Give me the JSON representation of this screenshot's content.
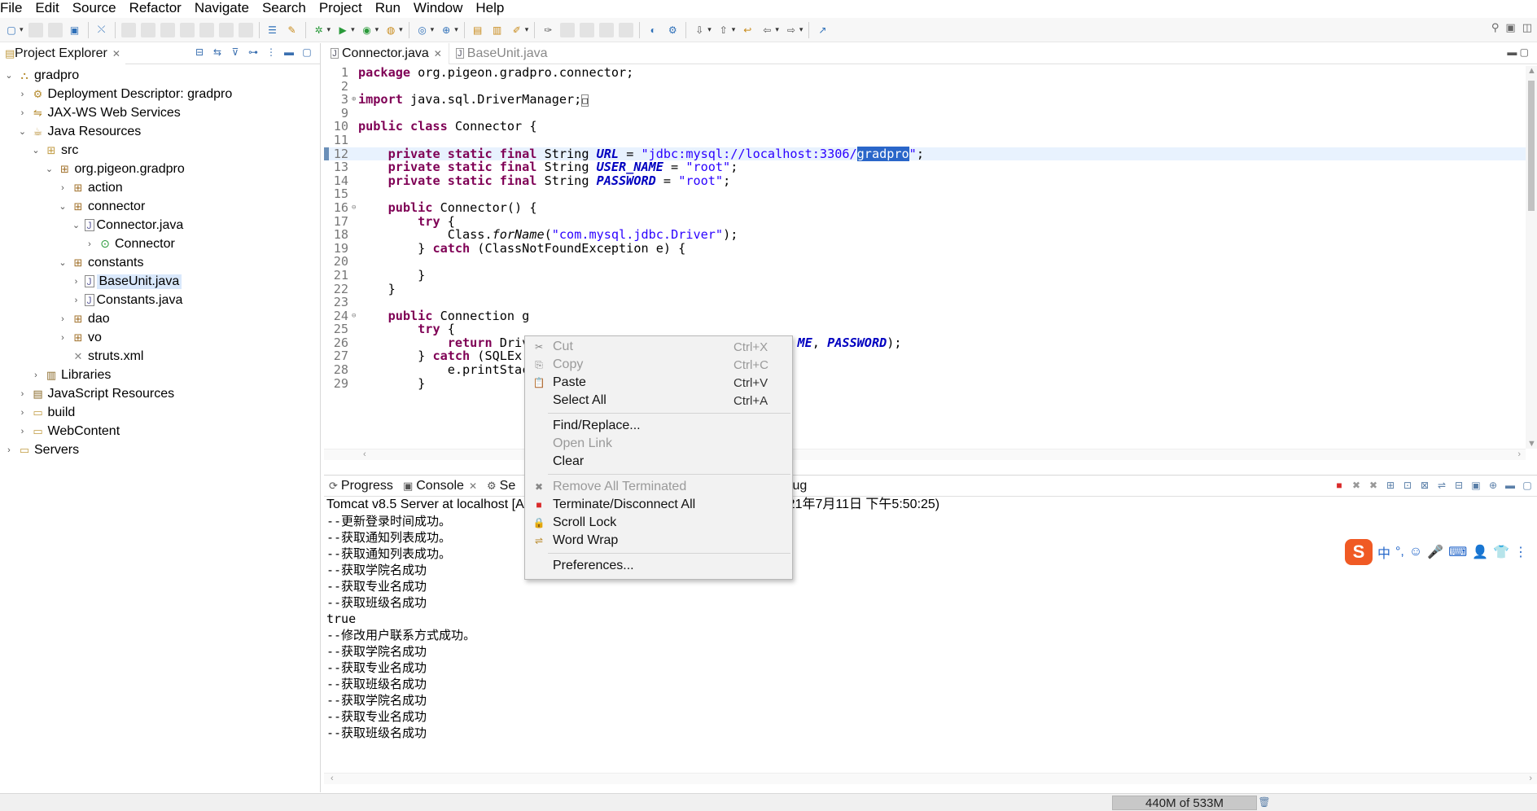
{
  "menu": [
    "File",
    "Edit",
    "Source",
    "Refactor",
    "Navigate",
    "Search",
    "Project",
    "Run",
    "Window",
    "Help"
  ],
  "project_explorer": {
    "title": "Project Explorer",
    "tree": [
      {
        "label": "gradpro",
        "depth": 0,
        "twisty": "open",
        "icon": "project-icon"
      },
      {
        "label": "Deployment Descriptor: gradpro",
        "depth": 1,
        "twisty": "closed",
        "icon": "descriptor-icon"
      },
      {
        "label": "JAX-WS Web Services",
        "depth": 1,
        "twisty": "closed",
        "icon": "webservice-icon"
      },
      {
        "label": "Java Resources",
        "depth": 1,
        "twisty": "open",
        "icon": "java-resources-icon"
      },
      {
        "label": "src",
        "depth": 2,
        "twisty": "open",
        "icon": "source-folder-icon"
      },
      {
        "label": "org.pigeon.gradpro",
        "depth": 3,
        "twisty": "open",
        "icon": "package-icon"
      },
      {
        "label": "action",
        "depth": 4,
        "twisty": "closed",
        "icon": "package-icon"
      },
      {
        "label": "connector",
        "depth": 4,
        "twisty": "open",
        "icon": "package-icon"
      },
      {
        "label": "Connector.java",
        "depth": 5,
        "twisty": "open",
        "icon": "java-file-icon"
      },
      {
        "label": "Connector",
        "depth": 6,
        "twisty": "closed",
        "icon": "class-icon"
      },
      {
        "label": "constants",
        "depth": 4,
        "twisty": "open",
        "icon": "package-icon"
      },
      {
        "label": "BaseUnit.java",
        "depth": 5,
        "twisty": "closed",
        "icon": "java-file-icon",
        "selected": true
      },
      {
        "label": "Constants.java",
        "depth": 5,
        "twisty": "closed",
        "icon": "java-file-icon"
      },
      {
        "label": "dao",
        "depth": 4,
        "twisty": "closed",
        "icon": "package-icon"
      },
      {
        "label": "vo",
        "depth": 4,
        "twisty": "closed",
        "icon": "package-icon"
      },
      {
        "label": "struts.xml",
        "depth": 4,
        "twisty": "none",
        "icon": "xml-file-icon"
      },
      {
        "label": "Libraries",
        "depth": 2,
        "twisty": "closed",
        "icon": "library-icon"
      },
      {
        "label": "JavaScript Resources",
        "depth": 1,
        "twisty": "closed",
        "icon": "js-resources-icon"
      },
      {
        "label": "build",
        "depth": 1,
        "twisty": "closed",
        "icon": "folder-icon"
      },
      {
        "label": "WebContent",
        "depth": 1,
        "twisty": "closed",
        "icon": "folder-icon"
      },
      {
        "label": "Servers",
        "depth": 0,
        "twisty": "closed",
        "icon": "folder-icon"
      }
    ]
  },
  "editor": {
    "tabs": [
      {
        "label": "Connector.java",
        "active": true
      },
      {
        "label": "BaseUnit.java",
        "active": false
      }
    ],
    "lines": [
      {
        "n": "1",
        "fold": "",
        "segs": [
          [
            "kw",
            "package"
          ],
          [
            "t",
            " org.pigeon.gradpro.connector;"
          ]
        ]
      },
      {
        "n": "2",
        "fold": "",
        "segs": []
      },
      {
        "n": "3",
        "fold": "⊕",
        "segs": [
          [
            "kw",
            "import"
          ],
          [
            "t",
            " java.sql.DriverManager;"
          ],
          [
            "box",
            "□"
          ]
        ]
      },
      {
        "n": "9",
        "fold": "",
        "segs": []
      },
      {
        "n": "10",
        "fold": "",
        "segs": [
          [
            "kw",
            "public class"
          ],
          [
            "t",
            " Connector {"
          ]
        ]
      },
      {
        "n": "11",
        "fold": "",
        "segs": []
      },
      {
        "n": "12",
        "fold": "",
        "cur": true,
        "segs": [
          [
            "t",
            "    "
          ],
          [
            "kw",
            "private static final"
          ],
          [
            "t",
            " String "
          ],
          [
            "cst",
            "URL"
          ],
          [
            "t",
            " = "
          ],
          [
            "str",
            "\"jdbc:mysql://localhost:3306/"
          ],
          [
            "hl",
            "gradpro"
          ],
          [
            "str",
            "\""
          ],
          [
            "t",
            ";"
          ]
        ]
      },
      {
        "n": "13",
        "fold": "",
        "segs": [
          [
            "t",
            "    "
          ],
          [
            "kw",
            "private static final"
          ],
          [
            "t",
            " String "
          ],
          [
            "cst",
            "USER_NAME"
          ],
          [
            "t",
            " = "
          ],
          [
            "str",
            "\"root\""
          ],
          [
            "t",
            ";"
          ]
        ]
      },
      {
        "n": "14",
        "fold": "",
        "segs": [
          [
            "t",
            "    "
          ],
          [
            "kw",
            "private static final"
          ],
          [
            "t",
            " String "
          ],
          [
            "cst",
            "PASSWORD"
          ],
          [
            "t",
            " = "
          ],
          [
            "str",
            "\"root\""
          ],
          [
            "t",
            ";"
          ]
        ]
      },
      {
        "n": "15",
        "fold": "",
        "segs": []
      },
      {
        "n": "16",
        "fold": "⊖",
        "segs": [
          [
            "t",
            "    "
          ],
          [
            "kw",
            "public"
          ],
          [
            "t",
            " Connector() {"
          ]
        ]
      },
      {
        "n": "17",
        "fold": "",
        "segs": [
          [
            "t",
            "        "
          ],
          [
            "kw",
            "try"
          ],
          [
            "t",
            " {"
          ]
        ]
      },
      {
        "n": "18",
        "fold": "",
        "segs": [
          [
            "t",
            "            Class."
          ],
          [
            "it",
            "forName"
          ],
          [
            "t",
            "("
          ],
          [
            "str",
            "\"com.mysql.jdbc.Driver\""
          ],
          [
            "t",
            ");"
          ]
        ]
      },
      {
        "n": "19",
        "fold": "",
        "segs": [
          [
            "t",
            "        } "
          ],
          [
            "kw",
            "catch"
          ],
          [
            "t",
            " (ClassNotFoundException e) {"
          ]
        ]
      },
      {
        "n": "20",
        "fold": "",
        "segs": []
      },
      {
        "n": "21",
        "fold": "",
        "segs": [
          [
            "t",
            "        }"
          ]
        ]
      },
      {
        "n": "22",
        "fold": "",
        "segs": [
          [
            "t",
            "    }"
          ]
        ]
      },
      {
        "n": "23",
        "fold": "",
        "segs": []
      },
      {
        "n": "24",
        "fold": "⊖",
        "segs": [
          [
            "t",
            "    "
          ],
          [
            "kw",
            "public"
          ],
          [
            "t",
            " Connection g"
          ]
        ]
      },
      {
        "n": "25",
        "fold": "",
        "segs": [
          [
            "t",
            "        "
          ],
          [
            "kw",
            "try"
          ],
          [
            "t",
            " {"
          ]
        ]
      },
      {
        "n": "26",
        "fold": "",
        "segs": [
          [
            "t",
            "            "
          ],
          [
            "kw",
            "return"
          ],
          [
            "t",
            " Driv                                    "
          ],
          [
            "cst",
            "ME"
          ],
          [
            "t",
            ", "
          ],
          [
            "cst",
            "PASSWORD"
          ],
          [
            "t",
            ");"
          ]
        ]
      },
      {
        "n": "27",
        "fold": "",
        "segs": [
          [
            "t",
            "        } "
          ],
          [
            "kw",
            "catch"
          ],
          [
            "t",
            " (SQLEx"
          ]
        ]
      },
      {
        "n": "28",
        "fold": "",
        "segs": [
          [
            "t",
            "            e.printStac"
          ]
        ]
      },
      {
        "n": "29",
        "fold": "",
        "segs": [
          [
            "t",
            "        }"
          ]
        ]
      }
    ]
  },
  "console": {
    "tabs": [
      {
        "label": "Progress",
        "icon": "progress-icon"
      },
      {
        "label": "Console",
        "icon": "console-icon",
        "active": true
      },
      {
        "label": "Se",
        "icon": "servers-icon"
      },
      {
        "label": "Debug",
        "icon": "debug-icon"
      }
    ],
    "header_left": "Tomcat v8.5 Server at localhost [A",
    "header_right": "0_67\\bin\\javaw.exe (2021年7月11日 下午5:50:25)",
    "lines": [
      "--更新登录时间成功。",
      "--获取通知列表成功。",
      "--获取通知列表成功。",
      "--获取学院名成功",
      "--获取专业名成功",
      "--获取班级名成功",
      "true",
      "--修改用户联系方式成功。",
      "--获取学院名成功",
      "--获取专业名成功",
      "--获取班级名成功",
      "--获取学院名成功",
      "--获取专业名成功",
      "--获取班级名成功"
    ]
  },
  "context_menu": {
    "groups": [
      [
        {
          "label": "Cut",
          "shortcut": "Ctrl+X",
          "disabled": true,
          "icon": "cut-icon"
        },
        {
          "label": "Copy",
          "shortcut": "Ctrl+C",
          "disabled": true,
          "icon": "copy-icon"
        },
        {
          "label": "Paste",
          "shortcut": "Ctrl+V",
          "disabled": false,
          "icon": "paste-icon"
        },
        {
          "label": "Select All",
          "shortcut": "Ctrl+A",
          "disabled": false,
          "icon": ""
        }
      ],
      [
        {
          "label": "Find/Replace...",
          "shortcut": "",
          "disabled": false,
          "icon": ""
        },
        {
          "label": "Open Link",
          "shortcut": "",
          "disabled": true,
          "icon": ""
        },
        {
          "label": "Clear",
          "shortcut": "",
          "disabled": false,
          "icon": ""
        }
      ],
      [
        {
          "label": "Remove All Terminated",
          "shortcut": "",
          "disabled": true,
          "icon": "remove-all-icon"
        },
        {
          "label": "Terminate/Disconnect All",
          "shortcut": "",
          "disabled": false,
          "icon": "terminate-all-icon"
        },
        {
          "label": "Scroll Lock",
          "shortcut": "",
          "disabled": false,
          "icon": "scroll-lock-icon"
        },
        {
          "label": "Word Wrap",
          "shortcut": "",
          "disabled": false,
          "icon": "word-wrap-icon"
        }
      ],
      [
        {
          "label": "Preferences...",
          "shortcut": "",
          "disabled": false,
          "icon": ""
        }
      ]
    ]
  },
  "status": {
    "heap": "440M of 533M"
  },
  "ime": {
    "labels": [
      "中",
      "°,",
      "☺",
      "🎤",
      "⌨",
      "👤",
      "👕",
      "⋮"
    ]
  },
  "colors": {
    "keyword": "#7f0055",
    "string": "#2a00ff",
    "constant": "#0000c0",
    "selection": "#2a66c9",
    "current_line": "#e8f2fe"
  }
}
